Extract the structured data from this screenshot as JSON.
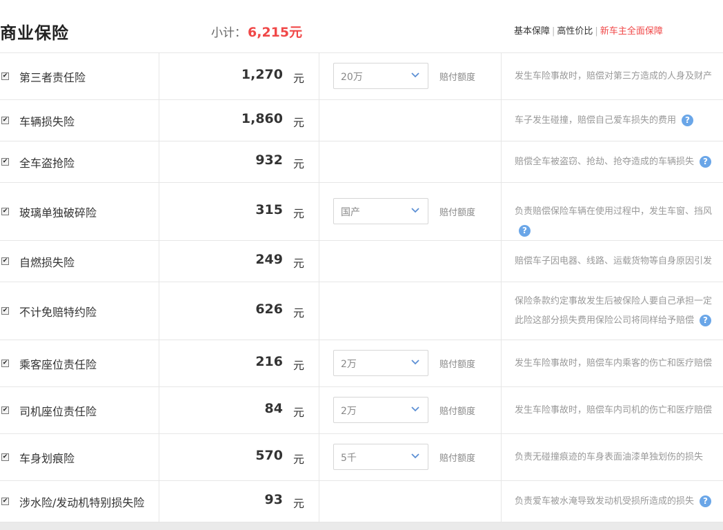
{
  "header": {
    "title": "商业保险",
    "subtotal_label": "小计：",
    "subtotal_value": "6,215元",
    "plans": [
      "基本保障",
      "高性价比",
      "新车主全面保障"
    ]
  },
  "unit": "元",
  "limit_label": "赔付额度",
  "rows": [
    {
      "name": "第三者责任险",
      "price": "1,270",
      "select": "20万",
      "desc": [
        "发生车险事故时，赔偿对第三方造成的人身及财产"
      ],
      "help": false
    },
    {
      "name": "车辆损失险",
      "price": "1,860",
      "select": null,
      "desc": [
        "车子发生碰撞，赔偿自己爱车损失的费用"
      ],
      "help": true
    },
    {
      "name": "全车盗抢险",
      "price": "932",
      "select": null,
      "desc": [
        "赔偿全车被盗窃、抢劫、抢夺造成的车辆损失"
      ],
      "help": true
    },
    {
      "name": "玻璃单独破碎险",
      "price": "315",
      "select": "国产",
      "desc": [
        "负责赔偿保险车辆在使用过程中，发生车窗、挡风"
      ],
      "help": true
    },
    {
      "name": "自燃损失险",
      "price": "249",
      "select": null,
      "desc": [
        "赔偿车子因电器、线路、运载货物等自身原因引发"
      ],
      "help": false
    },
    {
      "name": "不计免赔特约险",
      "price": "626",
      "select": null,
      "desc": [
        "保险条款约定事故发生后被保险人要自己承担一定",
        "此险这部分损失费用保险公司将同样给予赔偿"
      ],
      "help": true
    },
    {
      "name": "乘客座位责任险",
      "price": "216",
      "select": "2万",
      "desc": [
        "发生车险事故时，赔偿车内乘客的伤亡和医疗赔偿"
      ],
      "help": false
    },
    {
      "name": "司机座位责任险",
      "price": "84",
      "select": "2万",
      "desc": [
        "发生车险事故时，赔偿车内司机的伤亡和医疗赔偿"
      ],
      "help": false
    },
    {
      "name": "车身划痕险",
      "price": "570",
      "select": "5千",
      "desc": [
        "负责无碰撞痕迹的车身表面油漆单独划伤的损失"
      ],
      "help": false
    },
    {
      "name": "涉水险/发动机特别损失险",
      "price": "93",
      "select": null,
      "desc": [
        "负责爱车被水淹导致发动机受损所造成的损失"
      ],
      "help": true
    }
  ]
}
